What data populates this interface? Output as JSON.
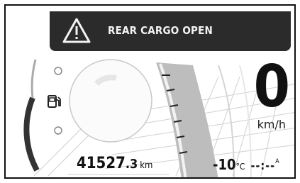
{
  "alert": {
    "message": "REAR CARGO OPEN",
    "icon": "warning-triangle-icon"
  },
  "speedometer": {
    "value": "0",
    "unit": "km/h"
  },
  "odometer": {
    "integer": "41527",
    "decimal": ".3",
    "unit": "km"
  },
  "outside_temp": {
    "value": "-10",
    "unit": "°C"
  },
  "clock": {
    "value": "--:--",
    "suffix": "A"
  },
  "fuel_gauge": {
    "icon": "fuel-pump-icon"
  },
  "colors": {
    "banner_bg": "#2b2b2b",
    "banner_text": "#f2f2f2",
    "gauge_dark": "#3a3a3a"
  }
}
